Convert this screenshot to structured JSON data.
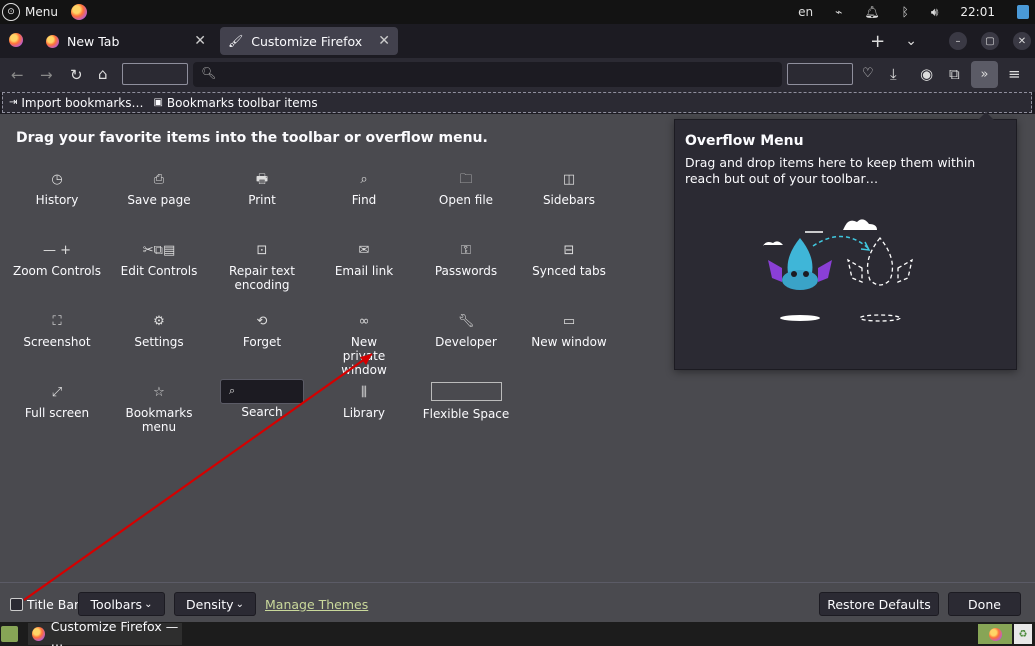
{
  "system_bar": {
    "menu_label": "Menu",
    "lang": "en",
    "clock": "22:01"
  },
  "tabs": [
    {
      "label": "New Tab",
      "active": false
    },
    {
      "label": "Customize Firefox",
      "active": true
    }
  ],
  "tab_actions": {
    "new_tab": "+",
    "list_all": "⌄"
  },
  "bookmarks": [
    {
      "label": "Import bookmarks…"
    },
    {
      "label": "Bookmarks toolbar items"
    }
  ],
  "customize": {
    "title": "Drag your favorite items into the toolbar or overflow menu.",
    "items": [
      {
        "label": "History",
        "icon": "clock-icon"
      },
      {
        "label": "Save page",
        "icon": "save-icon"
      },
      {
        "label": "Print",
        "icon": "print-icon"
      },
      {
        "label": "Find",
        "icon": "find-icon"
      },
      {
        "label": "Open file",
        "icon": "open-file-icon"
      },
      {
        "label": "Sidebars",
        "icon": "sidebar-icon"
      },
      {
        "label": "Zoom Controls",
        "icon": "zoom-icon"
      },
      {
        "label": "Edit Controls",
        "icon": "edit-icon"
      },
      {
        "label": "Repair text encoding",
        "icon": "encoding-icon"
      },
      {
        "label": "Email link",
        "icon": "email-icon"
      },
      {
        "label": "Passwords",
        "icon": "key-icon"
      },
      {
        "label": "Synced tabs",
        "icon": "synced-icon"
      },
      {
        "label": "Screenshot",
        "icon": "screenshot-icon"
      },
      {
        "label": "Settings",
        "icon": "gear-icon"
      },
      {
        "label": "Forget",
        "icon": "forget-icon"
      },
      {
        "label": "New private window",
        "icon": "mask-icon"
      },
      {
        "label": "Developer",
        "icon": "wrench-icon"
      },
      {
        "label": "New window",
        "icon": "window-icon"
      },
      {
        "label": "Full screen",
        "icon": "fullscreen-icon"
      },
      {
        "label": "Bookmarks menu",
        "icon": "bookmarks-icon"
      },
      {
        "label": "Search",
        "icon": "search-icon"
      },
      {
        "label": "Library",
        "icon": "library-icon"
      },
      {
        "label": "Flexible Space",
        "icon": "none"
      }
    ]
  },
  "overflow_menu": {
    "title": "Overflow Menu",
    "description": "Drag and drop items here to keep them within reach but out of your toolbar…"
  },
  "footer": {
    "title_bar_label": "Title Bar",
    "title_bar_checked": false,
    "toolbars_label": "Toolbars",
    "density_label": "Density",
    "manage_themes": "Manage Themes",
    "restore_defaults": "Restore Defaults",
    "done": "Done"
  },
  "taskbar": {
    "task_label": "Customize Firefox — …"
  },
  "colors": {
    "background": "#4a4a4f",
    "toolbar": "#2b2a33",
    "tab_active": "#42414d",
    "annotation_arrow": "#d40000"
  }
}
